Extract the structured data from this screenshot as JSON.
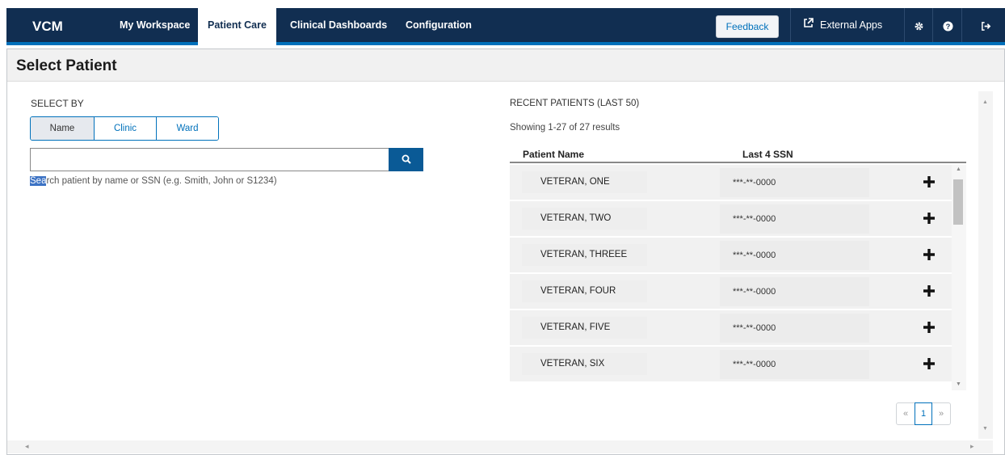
{
  "nav": {
    "brand": "VCM",
    "tabs": [
      {
        "label": "My Workspace"
      },
      {
        "label": "Patient Care"
      },
      {
        "label": "Clinical Dashboards"
      },
      {
        "label": "Configuration"
      }
    ],
    "active_tab": "Patient Care",
    "feedback_label": "Feedback",
    "external_apps_label": "External Apps",
    "icons": [
      "external-link-icon",
      "gear-icon",
      "help-icon",
      "logout-icon"
    ]
  },
  "page": {
    "title": "Select Patient"
  },
  "select_by": {
    "label": "SELECT BY",
    "options": [
      {
        "label": "Name"
      },
      {
        "label": "Clinic"
      },
      {
        "label": "Ward"
      }
    ],
    "selected": "Name"
  },
  "search": {
    "value": "",
    "placeholder": "",
    "hint_highlight": "Sea",
    "hint_rest": "rch patient by name or SSN (e.g. Smith, John or S1234)"
  },
  "recent": {
    "title": "RECENT PATIENTS (LAST 50)",
    "results_text": "Showing 1-27 of 27 results",
    "columns": [
      "Patient Name",
      "Last 4 SSN"
    ],
    "rows": [
      {
        "name": "VETERAN, ONE",
        "ssn": "***-**-0000"
      },
      {
        "name": "VETERAN, TWO",
        "ssn": "***-**-0000"
      },
      {
        "name": "VETERAN, THREEE",
        "ssn": "***-**-0000"
      },
      {
        "name": "VETERAN, FOUR",
        "ssn": "***-**-0000"
      },
      {
        "name": "VETERAN, FIVE",
        "ssn": "***-**-0000"
      },
      {
        "name": "VETERAN, SIX",
        "ssn": "***-**-0000"
      }
    ]
  },
  "pagination": {
    "prev": "«",
    "current": "1",
    "next": "»"
  },
  "colors": {
    "nav_bg": "#112e51",
    "accent": "#0071bb",
    "search_button": "#0a5a96"
  }
}
